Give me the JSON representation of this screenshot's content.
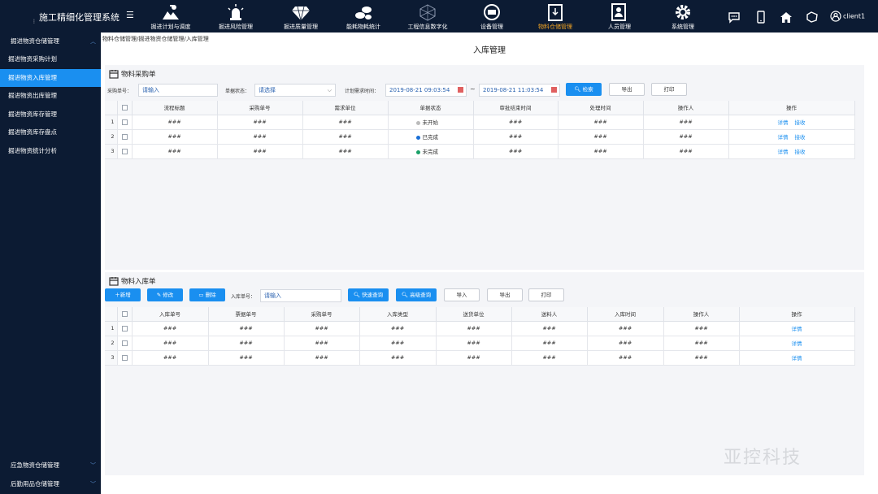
{
  "app": {
    "title": "施工精细化管理系统",
    "menu_glyph": "☰"
  },
  "nav": [
    {
      "label": "掘进计划与调度",
      "icon": "worker-hill-icon",
      "active": false
    },
    {
      "label": "掘进风险管理",
      "icon": "alarm-light-icon",
      "active": false
    },
    {
      "label": "掘进质量管理",
      "icon": "diamond-icon",
      "active": false
    },
    {
      "label": "能耗物耗统计",
      "icon": "barrels-icon",
      "active": false
    },
    {
      "label": "工程信息数字化",
      "icon": "network-icon",
      "active": false
    },
    {
      "label": "设备管理",
      "icon": "device-icon",
      "active": false
    },
    {
      "label": "物料仓储管理",
      "icon": "warehouse-icon",
      "active": true
    },
    {
      "label": "人员管理",
      "icon": "person-card-icon",
      "active": false
    },
    {
      "label": "系统管理",
      "icon": "gear-icon",
      "active": false
    }
  ],
  "user": {
    "name": "client1"
  },
  "colors": {
    "topbar": "#0c1b33",
    "accent": "#1a8ff0",
    "active_nav": "#f5a623"
  },
  "sidebar": {
    "groups": [
      {
        "label": "掘进物资仓储管理",
        "expanded": true
      },
      {
        "label": "应急物资仓储管理",
        "expanded": false
      },
      {
        "label": "后勤用品仓储管理",
        "expanded": false
      }
    ],
    "items": [
      {
        "label": "掘进物资采购计划",
        "active": false
      },
      {
        "label": "掘进物资入库管理",
        "active": true
      },
      {
        "label": "掘进物资出库管理",
        "active": false
      },
      {
        "label": "掘进物资库存管理",
        "active": false
      },
      {
        "label": "掘进物资库存盘点",
        "active": false
      },
      {
        "label": "掘进物资统计分析",
        "active": false
      }
    ]
  },
  "breadcrumb": "物料仓储管理/掘进物资仓储管理/入库管理",
  "page_title": "入库管理",
  "purchase": {
    "title": "物料采购单",
    "filter": {
      "order_no_label": "采购单号：",
      "order_no_placeholder": "请输入",
      "status_label": "单据状态：",
      "status_placeholder": "请选择",
      "time_label": "计划需求时间：",
      "date_from": "2019-08-21 09:03:54",
      "date_sep": "~",
      "date_to": "2019-08-21 11:03:54"
    },
    "buttons": {
      "search": "检索",
      "export": "导出",
      "print": "打印"
    },
    "columns": [
      "流程标题",
      "采购单号",
      "需求单位",
      "单据状态",
      "审批结束时间",
      "处理时间",
      "操作人",
      "操作"
    ],
    "rows": [
      {
        "no": "1",
        "title": "###",
        "order": "###",
        "unit": "###",
        "status": "未开始",
        "status_color": "#bbbbbb",
        "end": "###",
        "proc": "###",
        "op": "###",
        "a1": "详情",
        "a2": "接收"
      },
      {
        "no": "2",
        "title": "###",
        "order": "###",
        "unit": "###",
        "status": "已完成",
        "status_color": "#1a6fd6",
        "end": "###",
        "proc": "###",
        "op": "###",
        "a1": "详情",
        "a2": "接收"
      },
      {
        "no": "3",
        "title": "###",
        "order": "###",
        "unit": "###",
        "status": "未完成",
        "status_color": "#1aa068",
        "end": "###",
        "proc": "###",
        "op": "###",
        "a1": "详情",
        "a2": "接收"
      }
    ]
  },
  "inbound": {
    "title": "物料入库单",
    "buttons": {
      "add": "新增",
      "edit": "修改",
      "delete": "删除",
      "quick": "快速查询",
      "advanced": "高级查询",
      "import": "导入",
      "export": "导出",
      "print": "打印"
    },
    "filter": {
      "no_label": "入库单号：",
      "no_placeholder": "请输入"
    },
    "columns": [
      "入库单号",
      "票据单号",
      "采购单号",
      "入库类型",
      "送货单位",
      "送料人",
      "入库时间",
      "操作人",
      "操作"
    ],
    "rows": [
      {
        "no": "1",
        "c1": "###",
        "c2": "###",
        "c3": "###",
        "c4": "###",
        "c5": "###",
        "c6": "###",
        "c7": "###",
        "c8": "###",
        "a1": "详情"
      },
      {
        "no": "2",
        "c1": "###",
        "c2": "###",
        "c3": "###",
        "c4": "###",
        "c5": "###",
        "c6": "###",
        "c7": "###",
        "c8": "###",
        "a1": "详情"
      },
      {
        "no": "3",
        "c1": "###",
        "c2": "###",
        "c3": "###",
        "c4": "###",
        "c5": "###",
        "c6": "###",
        "c7": "###",
        "c8": "###",
        "a1": "详情"
      }
    ]
  },
  "watermark": "亚控科技"
}
